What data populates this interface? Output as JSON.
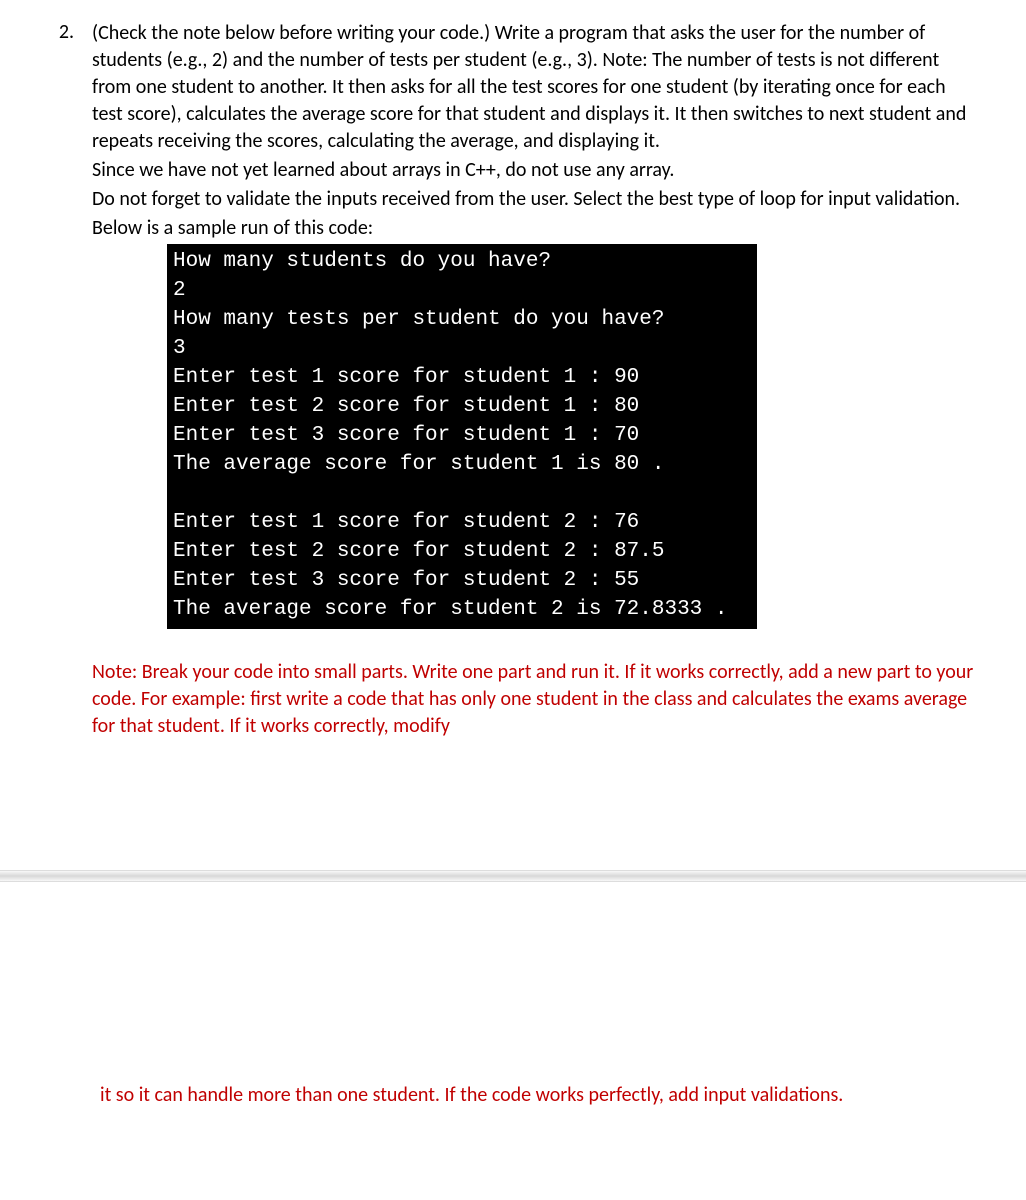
{
  "question": {
    "number": "2.",
    "text": "(Check the note below before writing your code.) Write a program that asks the user for the number of students (e.g., 2) and the number of tests per student (e.g., 3). Note: The number of tests is not different from one student to another. It then asks for all the test scores for one student (by iterating once for each test score), calculates the average score for that student and displays it. It then switches to next student and repeats receiving the scores, calculating the average, and displaying it.",
    "line2": "Since we have not yet learned about arrays in C++, do not use any array.",
    "line3": "Do not forget to validate the inputs received from the user. Select the best type of loop for input validation.",
    "line4": "Below is a sample run of this code:"
  },
  "console": {
    "lines": [
      "How many students do you have?",
      "2",
      "How many tests per student do you have?",
      "3",
      "Enter test 1 score for student 1 : 90",
      "Enter test 2 score for student 1 : 80",
      "Enter test 3 score for student 1 : 70",
      "The average score for student 1 is 80 .",
      "",
      "Enter test 1 score for student 2 : 76",
      "Enter test 2 score for student 2 : 87.5",
      "Enter test 3 score for student 2 : 55",
      "The average score for student 2 is 72.8333 ."
    ]
  },
  "note": {
    "part1": "Note: Break your code into small parts. Write one part and run it. If it works correctly, add a new part to your code. For example: first write a code that has only one student in the class and calculates the exams average for that student. If it works correctly, modify",
    "part2": "it so it can handle more than one student. If the code works perfectly, add input validations."
  }
}
